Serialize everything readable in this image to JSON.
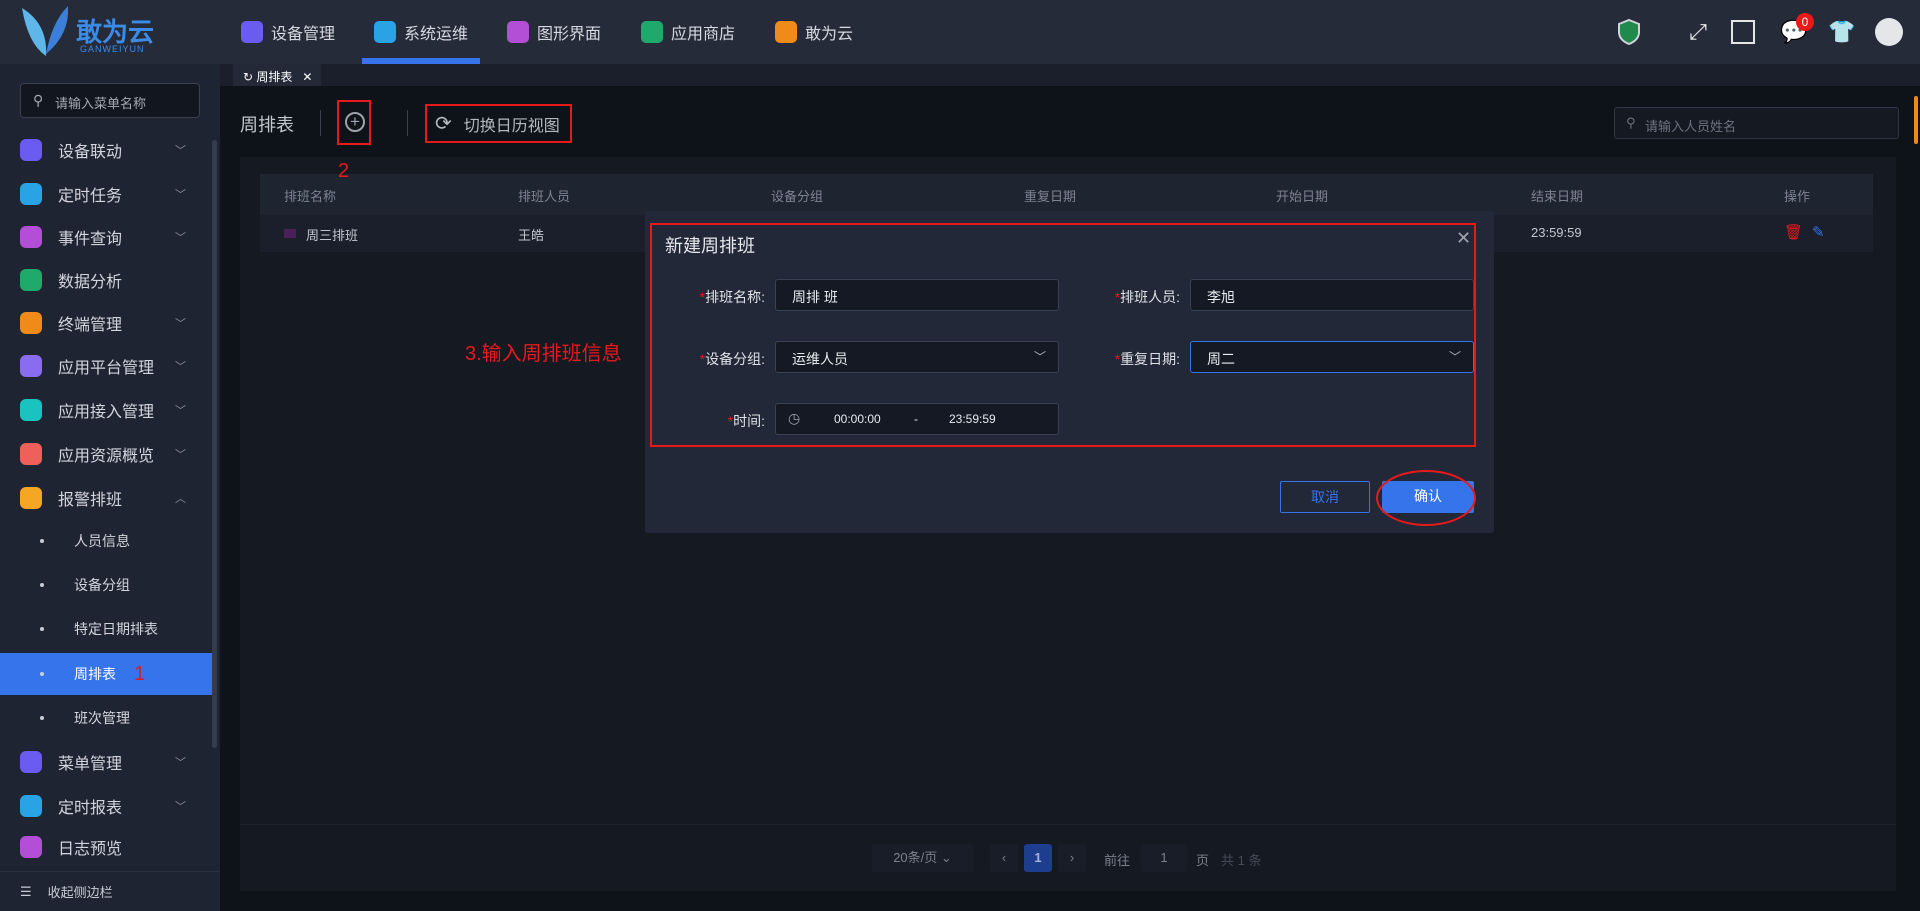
{
  "header": {
    "logo_text": "敢为云",
    "logo_sub": "GANWEIYUN",
    "nav": [
      {
        "label": "设备管理",
        "color": "#6a5cf0"
      },
      {
        "label": "系统运维",
        "color": "#29a3e6",
        "active": true
      },
      {
        "label": "图形界面",
        "color": "#b24fd6"
      },
      {
        "label": "应用商店",
        "color": "#1faa6b"
      },
      {
        "label": "敢为云",
        "color": "#f08a18"
      }
    ],
    "notification_count": "0"
  },
  "sidebar": {
    "search_placeholder": "请输入菜单名称",
    "items": [
      {
        "label": "设备联动",
        "color": "#6a5cf0"
      },
      {
        "label": "定时任务",
        "color": "#29a3e6"
      },
      {
        "label": "事件查询",
        "color": "#b24fd6"
      },
      {
        "label": "数据分析",
        "color": "#1faa6b"
      },
      {
        "label": "终端管理",
        "color": "#f08a18"
      },
      {
        "label": "应用平台管理",
        "color": "#8a6cf0"
      },
      {
        "label": "应用接入管理",
        "color": "#18c3c0"
      },
      {
        "label": "应用资源概览",
        "color": "#f0605a"
      },
      {
        "label": "报警排班",
        "color": "#f5a623"
      }
    ],
    "sub_items": [
      "人员信息",
      "设备分组",
      "特定日期排表",
      "周排表",
      "班次管理"
    ],
    "items_after": [
      {
        "label": "菜单管理",
        "color": "#6a5cf0"
      },
      {
        "label": "定时报表",
        "color": "#29a3e6"
      },
      {
        "label": "日志预览",
        "color": "#b24fd6"
      }
    ],
    "collapse_label": "收起侧边栏"
  },
  "tab": {
    "label": "周排表"
  },
  "toolbar": {
    "title": "周排表",
    "switch_label": "切换日历视图",
    "search_placeholder": "请输入人员姓名"
  },
  "annotations": {
    "step1": "1",
    "step2": "2",
    "step3": "3.输入周排班信息"
  },
  "table": {
    "columns": [
      "排班名称",
      "排班人员",
      "设备分组",
      "重复日期",
      "开始日期",
      "结束日期",
      "操作"
    ],
    "rows": [
      {
        "name": "周三排班",
        "person": "王皓",
        "end": "23:59:59"
      }
    ]
  },
  "pagination": {
    "page_size": "20条/页",
    "current": "1",
    "goto_label": "前往",
    "goto_value": "1",
    "page_suffix": "页",
    "total": "共 1 条"
  },
  "dialog": {
    "title": "新建周排班",
    "name_label": "排班名称:",
    "name_value": "周排 班",
    "person_label": "排班人员:",
    "person_value": "李旭",
    "group_label": "设备分组:",
    "group_value": "运维人员",
    "repeat_label": "重复日期:",
    "repeat_value": "周二",
    "time_label": "时间:",
    "time_start": "00:00:00",
    "time_sep": "-",
    "time_end": "23:59:59",
    "cancel": "取消",
    "confirm": "确认"
  }
}
